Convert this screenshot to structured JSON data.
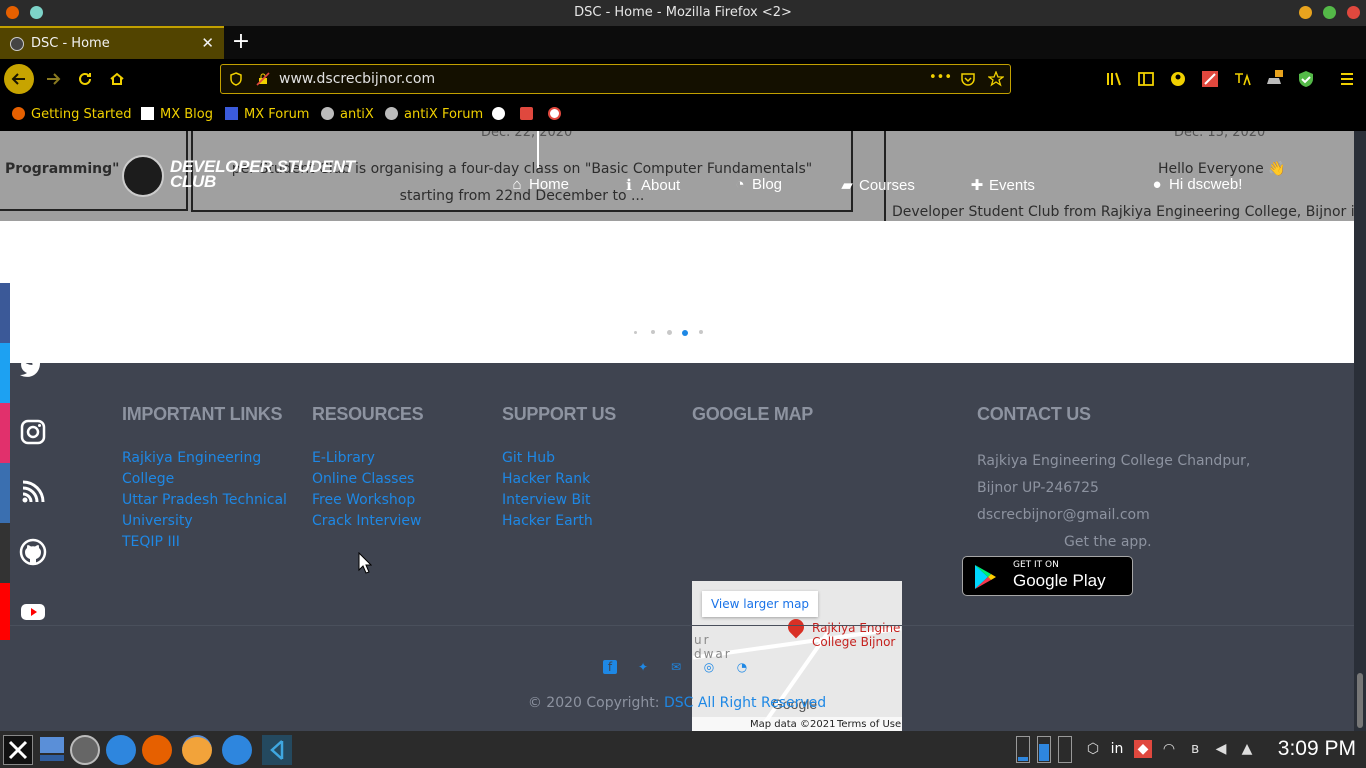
{
  "window": {
    "title": "DSC - Home - Mozilla Firefox <2>"
  },
  "tab": {
    "label": "DSC - Home",
    "close_glyph": "✕",
    "new_glyph": "+"
  },
  "urlbar": {
    "url": "www.dscrecbijnor.com",
    "more_glyph": "•••"
  },
  "bookmarks": [
    {
      "label": "Getting Started"
    },
    {
      "label": "MX Blog"
    },
    {
      "label": "MX Forum"
    },
    {
      "label": "antiX"
    },
    {
      "label": "antiX Forum"
    }
  ],
  "hero": {
    "cards": [
      {
        "text": "Programming\" st"
      },
      {
        "date": "Dec. 22, 2020",
        "line1": "per Student Club is organising a four-day class on \"Basic Computer Fundamentals\"",
        "line2": "starting from 22nd December to ..."
      },
      {
        "date": "Dec. 15, 2020",
        "line1": "Hello Everyone 👋",
        "line2": "Developer Student Club from Rajkiya Engineering College, Bijnor is invit"
      }
    ],
    "brand_line1": "DEVELOPER STUDENT",
    "brand_line2": "CLUB",
    "menu": [
      {
        "label": "Home"
      },
      {
        "label": "About"
      },
      {
        "label": "Blog"
      },
      {
        "label": "Courses"
      },
      {
        "label": "Events"
      },
      {
        "label": "Hi dscweb!"
      }
    ],
    "active_dot": 3
  },
  "footer": {
    "important_links": {
      "title": "IMPORTANT LINKS",
      "items": [
        "Rajkiya Engineering",
        "College",
        "Uttar Pradesh Technical",
        "University",
        "TEQIP III"
      ]
    },
    "resources": {
      "title": "RESOURCES",
      "items": [
        "E-Library",
        "Online Classes",
        "Free Workshop",
        "Crack Interview"
      ]
    },
    "support": {
      "title": "SUPPORT US",
      "items": [
        "Git Hub",
        "Hacker Rank",
        "Interview Bit",
        "Hacker Earth"
      ]
    },
    "map": {
      "title": "GOOGLE MAP",
      "button": "View larger map",
      "place_line1": "Rajkiya Engine",
      "place_line2": "College Bijnor",
      "place_left1": "ur",
      "place_left2": "dwar",
      "brand": "Google",
      "copyright": "Map data ©2021",
      "terms": "Terms of Use"
    },
    "contact": {
      "title": "CONTACT US",
      "address1": "Rajkiya Engineering College Chandpur,",
      "address2": "Bijnor UP-246725",
      "email": "dscrecbijnor@gmail.com",
      "app": "Get the app.",
      "gplay_small": "GET IT ON",
      "gplay_big": "Google Play"
    },
    "copyright_prefix": "© 2020 Copyright:",
    "copyright_link": "DSC All Right Reserved"
  },
  "taskbar": {
    "clock": "3:09 PM",
    "lang": "in"
  },
  "colors": {
    "accent": "#c2a000",
    "link": "#1e88e5",
    "footer_bg": "#3f4450",
    "heading": "#8d93a0"
  }
}
